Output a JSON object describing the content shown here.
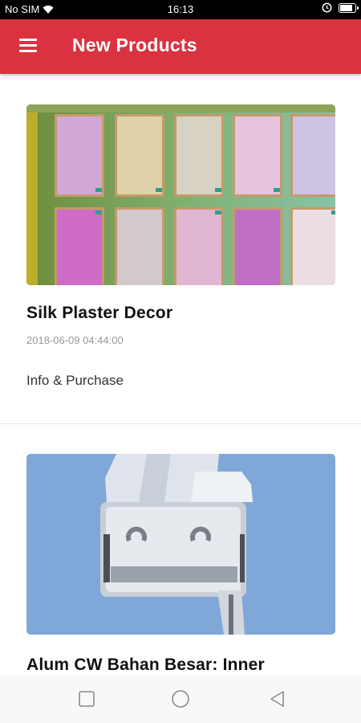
{
  "status_bar": {
    "carrier": "No SIM",
    "time": "16:13",
    "battery_level": 0.9,
    "icons": [
      "wifi-icon",
      "alarm-icon",
      "battery-icon"
    ]
  },
  "app_bar": {
    "title": "New Products",
    "color": "#da323e",
    "menu_icon": "hamburger-menu-icon"
  },
  "products": [
    {
      "title": "Silk Plaster Decor",
      "date": "2018-06-09 04:44:00",
      "action": "Info & Purchase",
      "image": "silk-plaster-samples-photo"
    },
    {
      "title": "Alum CW Bahan Besar: Inner",
      "image": "aluminium-profile-photo"
    }
  ],
  "nav_bar": {
    "icons": [
      "recent-apps-icon",
      "home-icon",
      "back-icon"
    ]
  }
}
